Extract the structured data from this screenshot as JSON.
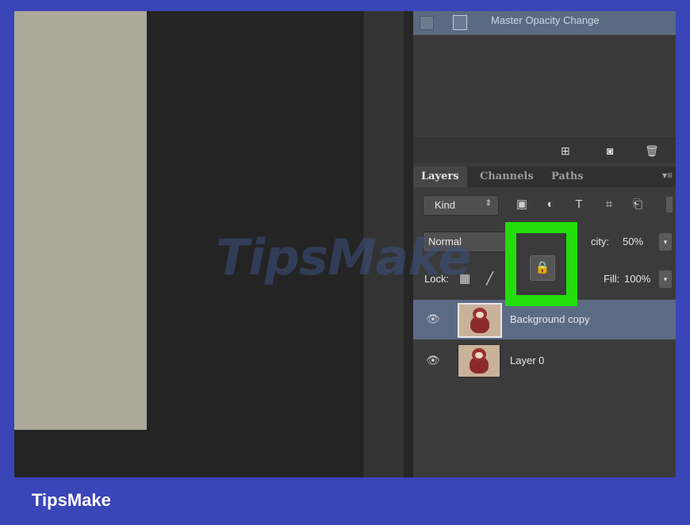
{
  "history": {
    "item_label": "Master Opacity Change",
    "toolbar_icons": [
      "new-document-icon",
      "camera-icon",
      "trash-icon"
    ]
  },
  "layers_panel": {
    "tabs": [
      {
        "label": "Layers",
        "active": true
      },
      {
        "label": "Channels",
        "active": false
      },
      {
        "label": "Paths",
        "active": false
      }
    ],
    "filter": {
      "kind_label": "Kind",
      "icons": [
        "image-filter-icon",
        "adjustment-filter-icon",
        "type-filter-icon",
        "shape-filter-icon",
        "smart-object-filter-icon"
      ]
    },
    "blend_mode": "Normal",
    "opacity_label": "city:",
    "opacity_value": "50%",
    "lock_label": "Lock:",
    "fill_label": "Fill:",
    "fill_value": "100%",
    "lock_all_icon": "lock-icon",
    "layers": [
      {
        "name": "Background copy",
        "selected": true
      },
      {
        "name": "Layer 0",
        "selected": false
      }
    ]
  },
  "highlight_color": "#22dd0a",
  "watermark_text": "TipsMake",
  "banner_text": "TipsMake",
  "colors": {
    "frame": "#3a45b8",
    "selected_layer": "#5c6b84",
    "panel": "#3b3b3b"
  }
}
